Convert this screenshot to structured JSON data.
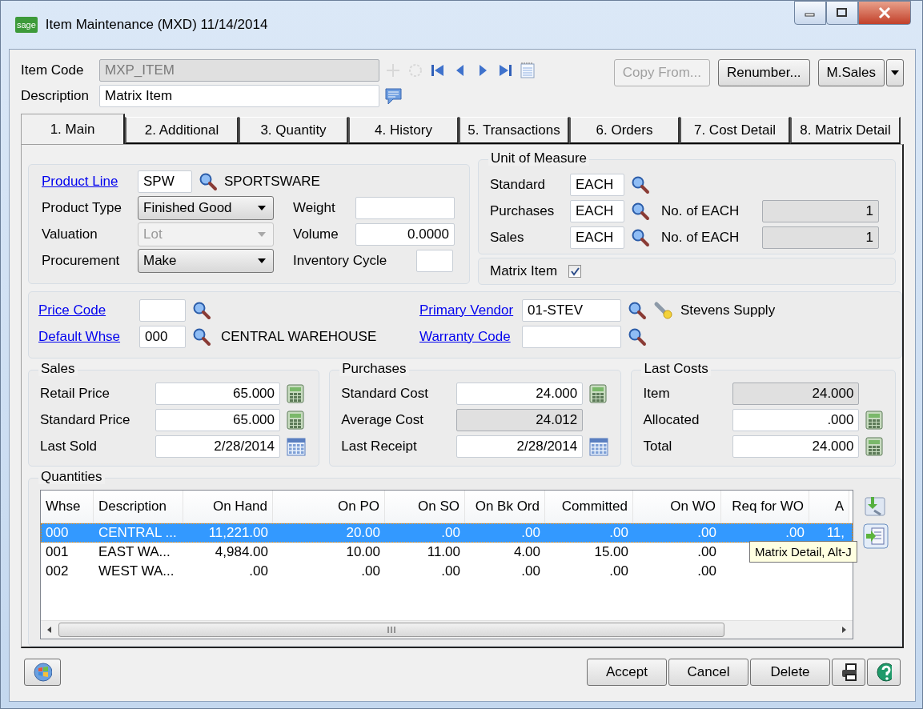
{
  "window": {
    "logo": "sage",
    "title": "Item Maintenance (MXD) 11/14/2014"
  },
  "item_code": {
    "label": "Item Code",
    "value": "MXP_ITEM",
    "disabled": true
  },
  "description": {
    "label": "Description",
    "value": "Matrix Item"
  },
  "header_buttons": [
    {
      "label": "Copy From...",
      "disabled": true
    },
    {
      "label": "Renumber...",
      "disabled": false
    },
    {
      "label": "M.Sales",
      "disabled": false
    }
  ],
  "tabs": [
    {
      "label": "1. Main",
      "selected": true
    },
    {
      "label": "2. Additional",
      "selected": false
    },
    {
      "label": "3. Quantity",
      "selected": false
    },
    {
      "label": "4. History",
      "selected": false
    },
    {
      "label": "5. Transactions",
      "selected": false
    },
    {
      "label": "6. Orders",
      "selected": false
    },
    {
      "label": "7. Cost Detail",
      "selected": false
    },
    {
      "label": "8. Matrix Detail",
      "selected": false
    }
  ],
  "product": {
    "product_line": {
      "label": "Product Line",
      "value": "SPW",
      "desc": "SPORTSWARE"
    },
    "selects": [
      {
        "label": "Product Type",
        "value": "Finished Good",
        "disabled": false
      },
      {
        "label": "Valuation",
        "value": "Lot",
        "disabled": true
      },
      {
        "label": "Procurement",
        "value": "Make",
        "disabled": false
      }
    ],
    "measures": [
      {
        "label": "Weight",
        "kind": "wide"
      },
      {
        "label": "Volume",
        "value": "0.0000",
        "kind": "wide"
      },
      {
        "label": "Inventory Cycle",
        "kind": "short"
      }
    ]
  },
  "unit_of_measure": {
    "title": "Unit of Measure",
    "rows": [
      {
        "label": "Standard",
        "value": "EACH"
      },
      {
        "label": "Purchases",
        "value": "EACH",
        "factor_label": "No. of EACH",
        "factor": "1"
      },
      {
        "label": "Sales",
        "value": "EACH",
        "factor_label": "No. of EACH",
        "factor": "1"
      }
    ]
  },
  "matrix_item": {
    "label": "Matrix Item",
    "checked": true
  },
  "codes": {
    "price_code": {
      "label": "Price Code"
    },
    "default_whse": {
      "label": "Default Whse",
      "value": "000",
      "desc": "CENTRAL WAREHOUSE"
    },
    "primary_vendor": {
      "label": "Primary Vendor",
      "value": "01-STEV",
      "desc": "Stevens Supply"
    },
    "warranty_code": {
      "label": "Warranty Code"
    }
  },
  "sales": {
    "title": "Sales",
    "rows": [
      {
        "label": "Retail Price",
        "value": "65.000",
        "kind": "calculator",
        "disabled": false
      },
      {
        "label": "Standard Price",
        "value": "65.000",
        "kind": "calculator",
        "disabled": false
      },
      {
        "label": "Last Sold",
        "value": "2/28/2014",
        "kind": "calendar",
        "disabled": false
      }
    ]
  },
  "purchases": {
    "title": "Purchases",
    "rows": [
      {
        "label": "Standard Cost",
        "value": "24.000",
        "kind": "calculator",
        "disabled": false
      },
      {
        "label": "Average Cost",
        "value": "24.012",
        "kind": "plain",
        "disabled": true
      },
      {
        "label": "Last Receipt",
        "value": "2/28/2014",
        "kind": "calendar",
        "disabled": false
      }
    ]
  },
  "last_costs": {
    "title": "Last Costs",
    "rows": [
      {
        "label": "Item",
        "value": "24.000",
        "kind": "plain",
        "disabled": true
      },
      {
        "label": "Allocated",
        "value": ".000",
        "kind": "calculator",
        "disabled": false
      },
      {
        "label": "Total",
        "value": "24.000",
        "kind": "calculator",
        "disabled": false
      }
    ]
  },
  "quantities": {
    "title": "Quantities",
    "columns": [
      "Whse",
      "Description",
      "On Hand",
      "On PO",
      "On SO",
      "On Bk Ord",
      "Committed",
      "On WO",
      "Req for WO",
      "A"
    ],
    "rows": [
      {
        "selected": true,
        "cells": [
          "000",
          "CENTRAL ...",
          "11,221.00",
          "20.00",
          ".00",
          ".00",
          ".00",
          ".00",
          ".00",
          "11,"
        ]
      },
      {
        "selected": false,
        "cells": [
          "001",
          "EAST WA...",
          "4,984.00",
          "10.00",
          "11.00",
          "4.00",
          "15.00",
          ".00",
          null,
          null
        ]
      },
      {
        "selected": false,
        "cells": [
          "002",
          "WEST WA...",
          ".00",
          ".00",
          ".00",
          ".00",
          ".00",
          ".00",
          null,
          null
        ]
      }
    ]
  },
  "tooltip": "Matrix Detail, Alt-J",
  "footer_buttons": [
    "Accept",
    "Cancel",
    "Delete"
  ]
}
